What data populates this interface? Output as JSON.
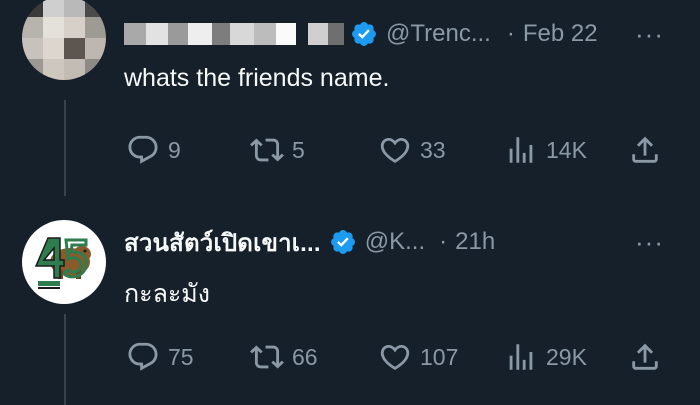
{
  "tweets": [
    {
      "handle": "@Trenc...",
      "time": "Feb 22",
      "more": "···",
      "text": "whats the friends name.",
      "stats": {
        "replies": "9",
        "reposts": "5",
        "likes": "33",
        "views": "14K"
      }
    },
    {
      "display_name": "สวนสัตว์เปิดเขาเ...",
      "handle": "@K...",
      "time": "21h",
      "more": "···",
      "text": "กะละมัง",
      "stats": {
        "replies": "75",
        "reposts": "66",
        "likes": "107",
        "views": "29K"
      }
    }
  ],
  "colors": {
    "background": "#15202b",
    "text": "#f7f9f9",
    "secondary": "#8b98a5",
    "verified": "#1d9bf0",
    "thread_line": "#38444d"
  },
  "icons": [
    "reply-icon",
    "repost-icon",
    "like-icon",
    "views-icon",
    "share-icon",
    "verified-badge-icon"
  ]
}
